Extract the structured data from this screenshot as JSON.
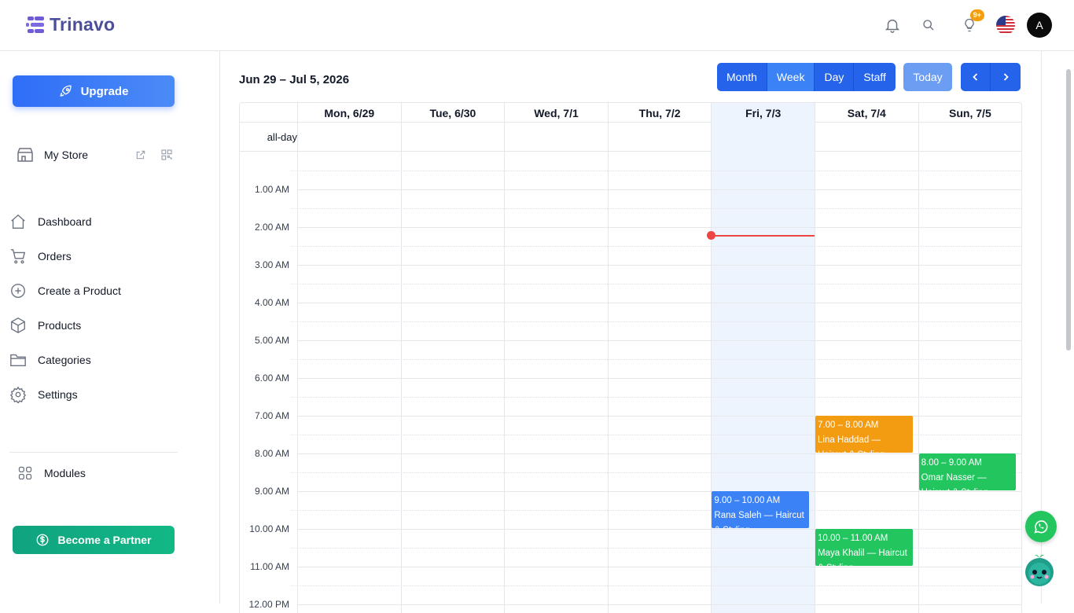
{
  "brand": {
    "name": "Trinavo",
    "color": "#4b4f9a"
  },
  "header": {
    "notifications_icon": "bell-icon",
    "search_icon": "search-icon",
    "ideas_icon": "lightbulb-icon",
    "ideas_badge": "9+",
    "language_icon": "us-flag-icon",
    "avatar_initial": "A"
  },
  "sidebar": {
    "upgrade_label": "Upgrade",
    "store_label": "My Store",
    "nav": [
      {
        "label": "Dashboard",
        "icon": "home-icon"
      },
      {
        "label": "Orders",
        "icon": "cart-icon"
      },
      {
        "label": "Create a Product",
        "icon": "plus-circle-icon"
      },
      {
        "label": "Products",
        "icon": "box-icon"
      },
      {
        "label": "Categories",
        "icon": "folder-icon"
      },
      {
        "label": "Settings",
        "icon": "gear-icon"
      }
    ],
    "modules_label": "Modules",
    "partner_label": "Become a Partner"
  },
  "calendar": {
    "range_title": "Jun 29 – Jul 5, 2026",
    "views": [
      "Month",
      "Week",
      "Day",
      "Staff"
    ],
    "active_view": "Week",
    "today_label": "Today",
    "allday_label": "all-day",
    "days": [
      "Mon, 6/29",
      "Tue, 6/30",
      "Wed, 7/1",
      "Thu, 7/2",
      "Fri, 7/3",
      "Sat, 7/4",
      "Sun, 7/5"
    ],
    "today_index": 4,
    "time_labels": [
      "1.00 AM",
      "2.00 AM",
      "3.00 AM",
      "4.00 AM",
      "5.00 AM",
      "6.00 AM",
      "7.00 AM",
      "8.00 AM",
      "9.00 AM",
      "10.00 AM",
      "11.00 AM",
      "12.00 PM"
    ],
    "now_hour": 2.2,
    "events": [
      {
        "day": 5,
        "start": 7,
        "end": 8,
        "time": "7.00 – 8.00 AM",
        "title": "Lina Haddad — Haircut & Styling",
        "color": "#f39c12"
      },
      {
        "day": 6,
        "start": 8,
        "end": 9,
        "time": "8.00 – 9.00 AM",
        "title": "Omar Nasser — Haircut & Styling",
        "color": "#22c55e"
      },
      {
        "day": 4,
        "start": 9,
        "end": 10,
        "time": "9.00 – 10.00 AM",
        "title": "Rana Saleh — Haircut & Styling",
        "color": "#3b82f6"
      },
      {
        "day": 5,
        "start": 10,
        "end": 11,
        "time": "10.00 – 11.00 AM",
        "title": "Maya Khalil — Haircut & Styling",
        "color": "#22c55e"
      }
    ]
  },
  "floating": {
    "whatsapp_icon": "whatsapp-icon",
    "assistant_icon": "assistant-bot-icon"
  }
}
